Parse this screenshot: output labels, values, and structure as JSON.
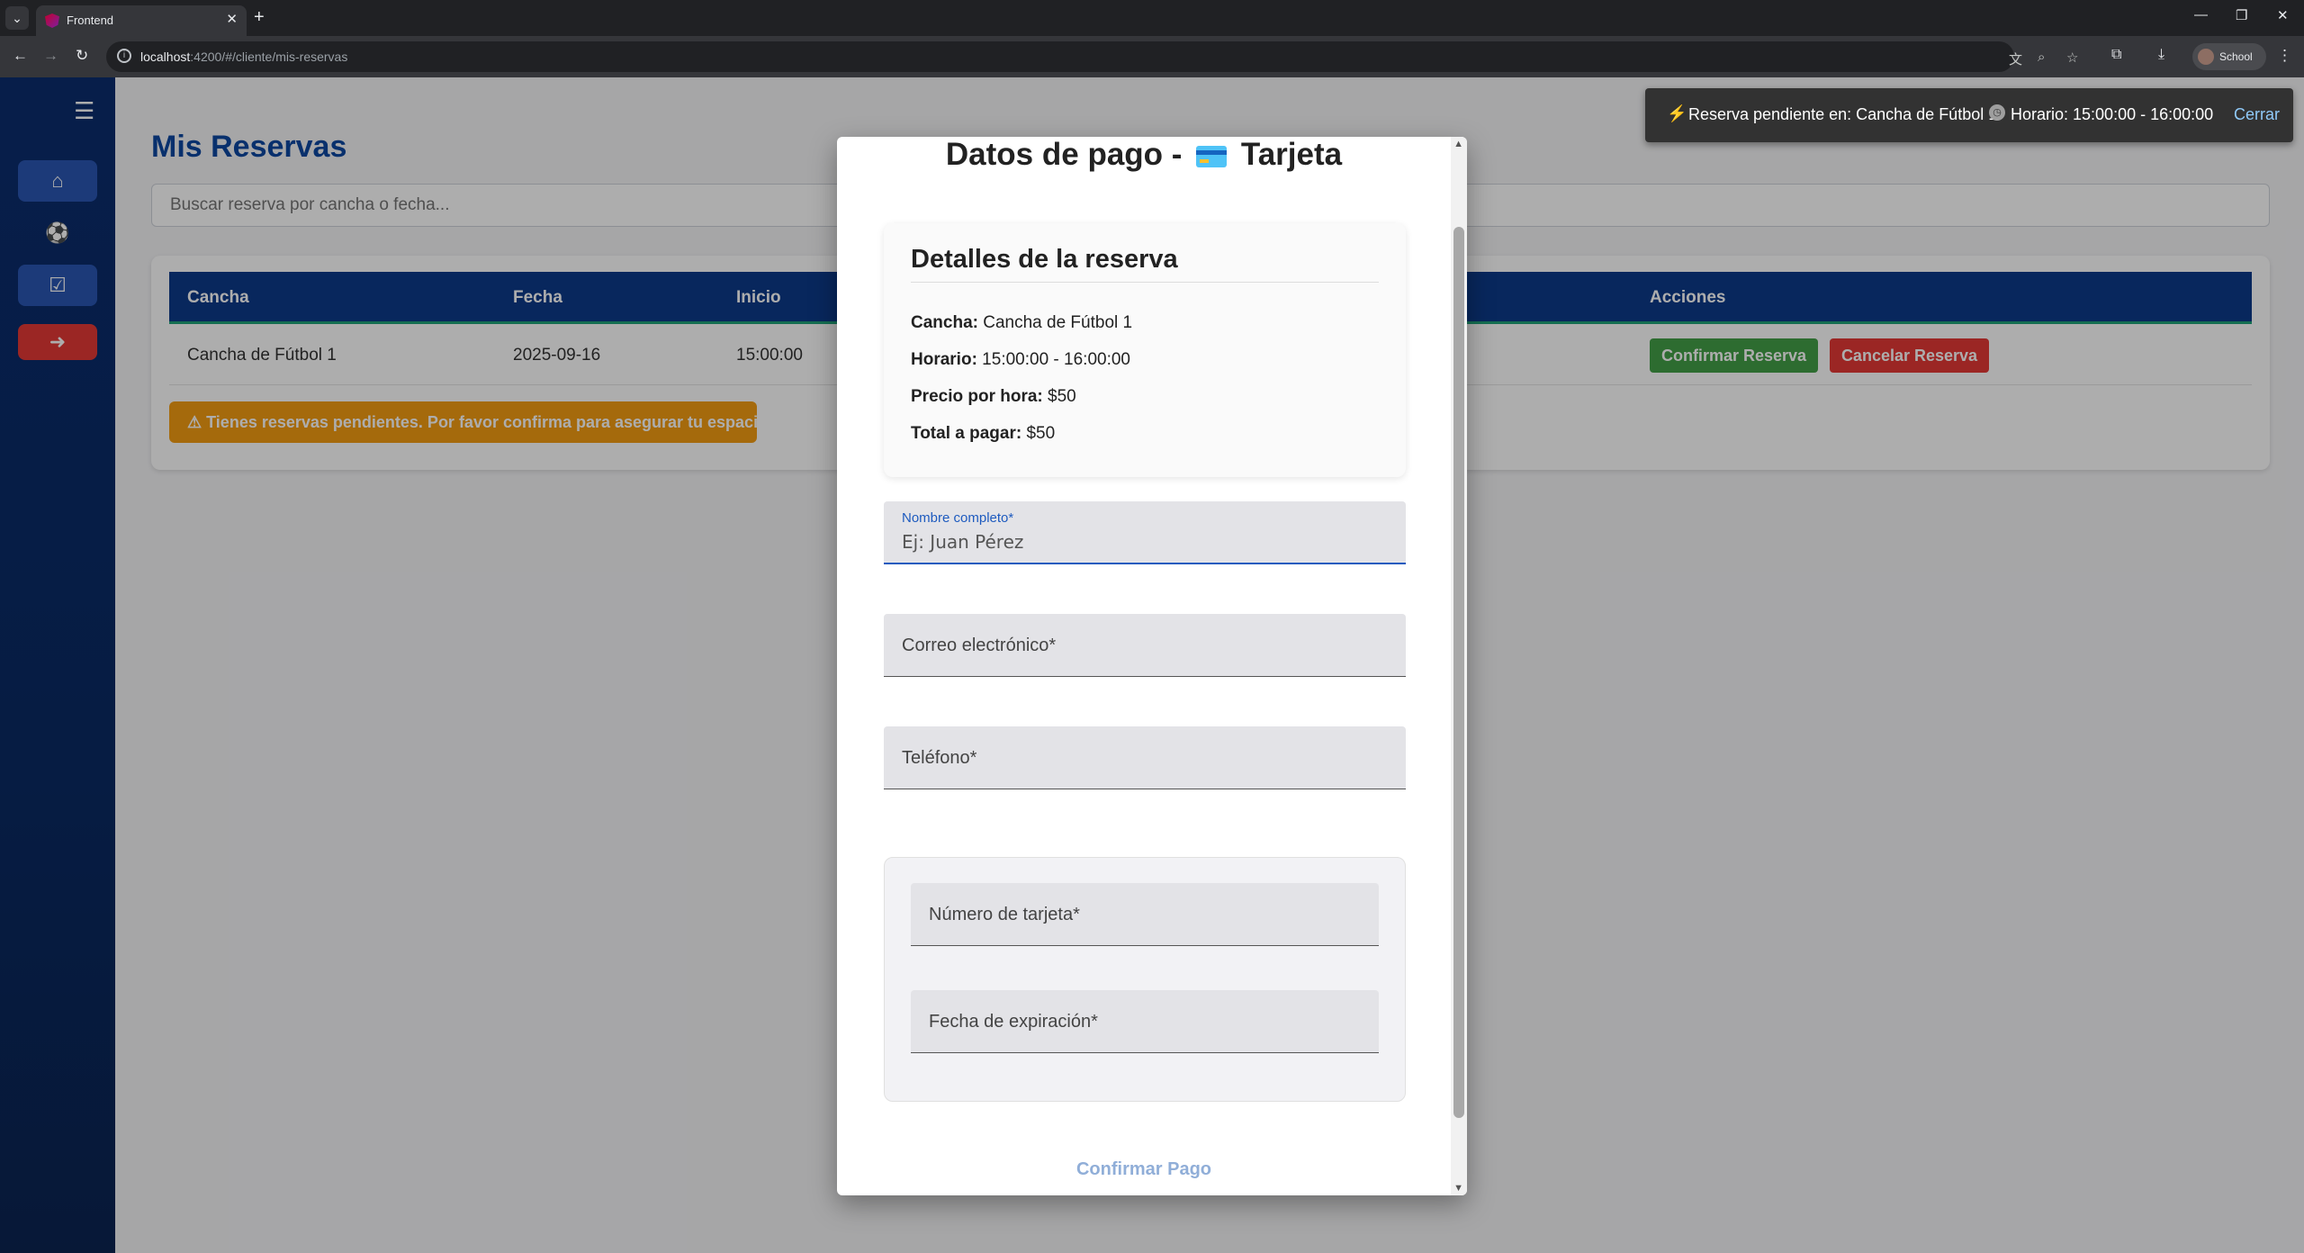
{
  "browser": {
    "tab_title": "Frontend",
    "url_host": "localhost",
    "url_rest": ":4200/#/cliente/mis-reservas",
    "profile_name": "School"
  },
  "sidebar": {
    "items": [
      {
        "icon": "home-icon"
      },
      {
        "icon": "soccer-ball-icon"
      },
      {
        "icon": "calendar-check-icon"
      },
      {
        "icon": "logout-icon"
      }
    ]
  },
  "main": {
    "title": "Mis Reservas",
    "search_placeholder": "Buscar reserva por cancha o fecha...",
    "table": {
      "headers": [
        "Cancha",
        "Fecha",
        "Inicio",
        "Acciones"
      ],
      "rows": [
        {
          "cancha": "Cancha de Fútbol 1",
          "fecha": "2025-09-16",
          "inicio": "15:00:00"
        }
      ],
      "confirm_label": "Confirmar Reserva",
      "cancel_label": "Cancelar Reserva"
    },
    "warning": "⚠ Tienes reservas pendientes. Por favor confirma para asegurar tu espacio."
  },
  "snackbar": {
    "message1": "Reserva pendiente en: Cancha de Fútbol 1",
    "message2": "Horario: 15:00:00 - 16:00:00",
    "close_label": "Cerrar"
  },
  "modal": {
    "title_prefix": "Datos de pago -",
    "title_method": "Tarjeta",
    "details": {
      "heading": "Detalles de la reserva",
      "cancha_label": "Cancha:",
      "cancha_value": " Cancha de Fútbol 1",
      "horario_label": "Horario:",
      "horario_value": " 15:00:00 - 16:00:00",
      "precio_label": "Precio por hora:",
      "precio_value": " $50",
      "total_label": "Total a pagar:",
      "total_value": " $50"
    },
    "fields": {
      "nombre_label": "Nombre completo*",
      "nombre_placeholder": "Ej: Juan Pérez",
      "correo_label": "Correo electrónico*",
      "telefono_label": "Teléfono*",
      "tarjeta_label": "Número de tarjeta*",
      "expiracion_label": "Fecha de expiración*"
    },
    "confirm_label": "Confirmar Pago"
  },
  "colors": {
    "primary": "#0d47a1",
    "sidebar": "#0b2d6e",
    "confirm_green": "#43a047",
    "cancel_red": "#e53935",
    "warning_orange": "#f39c12"
  }
}
